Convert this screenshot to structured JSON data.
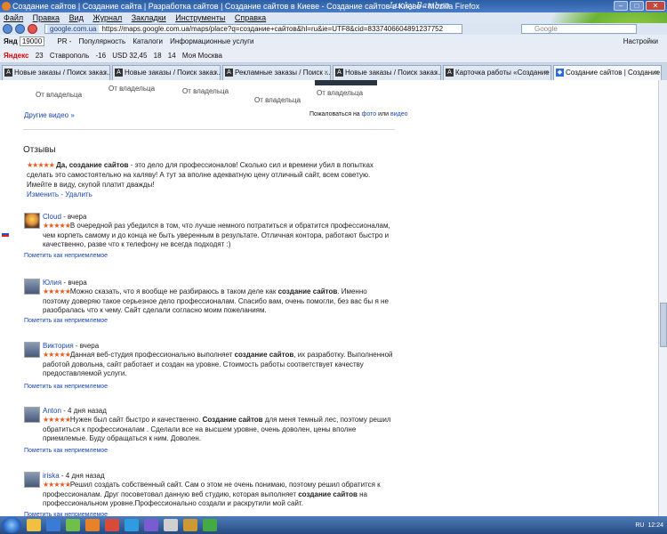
{
  "window": {
    "title": "Создание сайтов | Создание сайта | Разработка сайтов | Создание сайтов в Киеве - Создание сайтов в Киеве - Mozilla Firefox",
    "watermark": "Lucky Bamboo"
  },
  "menu": [
    "Файл",
    "Правка",
    "Вид",
    "Журнал",
    "Закладки",
    "Инструменты",
    "Справка"
  ],
  "nav": {
    "site_badge": "google.com.ua",
    "url": "https://maps.google.com.ua/maps/place?q=создание+сайтов&hl=ru&ie=UTF8&cid=8337406604891237752",
    "search_placeholder": "Google"
  },
  "bookmarks": {
    "yandex_label": "Янд",
    "yandex_count": "19000",
    "pr_label": "PR -",
    "items": [
      "Популярность",
      "Каталоги",
      "Информационные услуги"
    ],
    "settings": "Настройки"
  },
  "yandex_bar": {
    "logo": "Яндекс",
    "items": [
      "23",
      "Ставрополь",
      "-16",
      "USD 32,45",
      "18",
      "14",
      "Моя Москва"
    ]
  },
  "tabs": [
    {
      "icon": "A",
      "label": "Новые заказы / Поиск заказ...",
      "active": false
    },
    {
      "icon": "A",
      "label": "Новые заказы / Поиск заказ...",
      "active": false
    },
    {
      "icon": "A",
      "label": "Рекламные заказы / Поиск ...",
      "active": false
    },
    {
      "icon": "A",
      "label": "Новые заказы / Поиск заказ...",
      "active": false
    },
    {
      "icon": "A",
      "label": "Карточка работы «Создание ...",
      "active": false
    },
    {
      "icon": "◆",
      "label": "Создание сайтов | Создание ...",
      "active": true
    }
  ],
  "videos": {
    "owners": [
      "От владельца",
      "От владельца",
      "От владельца",
      "От владельца",
      "От владельца"
    ],
    "more": "Другие видео »",
    "complain_prefix": "Пожаловаться на",
    "complain_photo": "фото",
    "complain_or": "или",
    "complain_video": "видео"
  },
  "reviews": {
    "heading": "Отзывы",
    "mine": {
      "stars": "★★★★★",
      "title": "Да, создание сайтов",
      "text": " - это дело для профессионалов! Сколько сил и времени убил в попытках сделать это самостоятельно на халяву! А тут за вполне адекватную цену отличный сайт, всем советую. Имейте в виду, скупой платит дважды!",
      "edit": "Изменить",
      "delete": "Удалить"
    },
    "flag_label": "Пометить как неприемлемое",
    "items": [
      {
        "name": "Cloud",
        "when": " - вчера",
        "stars": "★★★★★",
        "pre": "В очередной раз убедился в том, что лучше немного потратиться и обратится профессионалам, чем корпеть самому и до конца не быть уверенным в результате. Отличная контора, работают быстро и качественно, разве что к телефону не всегда подходят :)",
        "bold": "",
        "post": ""
      },
      {
        "name": "Юлия",
        "when": " - вчера",
        "stars": "★★★★★",
        "pre": "Можно сказать, что я вообще не разбираюсь в таком деле как ",
        "bold": "создание сайтов",
        "post": ". Именно поэтому доверяю такое серьезное дело профессионалам. Спасибо вам, очень помогли, без вас бы я не разобралась что к чему. Сайт сделали согласно моим пожеланиям."
      },
      {
        "name": "Виктория",
        "when": " - вчера",
        "stars": "★★★★★",
        "pre": "Данная веб-студия профессионально выполняет ",
        "bold": "создание сайтов",
        "post": ", их разработку. Выполненной работой довольна, сайт работает и создан на уровне. Стоимость работы соответствует качеству предоставляемой услуги."
      },
      {
        "name": "Anton",
        "when": " - 4 дня назад",
        "stars": "★★★★★",
        "pre": "Нужен был сайт быстро и качественно. ",
        "bold": "Создание сайтов",
        "post": " для меня темный лес, поэтому решил обратиться к профессионалам . Сделали все на высшем уровне, очень доволен, цены вполне приемлемые. Буду обращаться к ним. Доволен."
      },
      {
        "name": "iriska",
        "when": " - 4 дня назад",
        "stars": "★★★★★",
        "pre": "Решил создать собственный сайт. Сам о этом не очень понимаю, поэтому решил обратится к профессионалам. Друг посоветовал данную веб студию, которая выполняет ",
        "bold": "создание сайтов",
        "post": " на профессиональном уровне.Профессионально создали и раскрутили мой сайт."
      }
    ]
  },
  "taskbar": {
    "lang": "RU",
    "time": "12:24"
  }
}
